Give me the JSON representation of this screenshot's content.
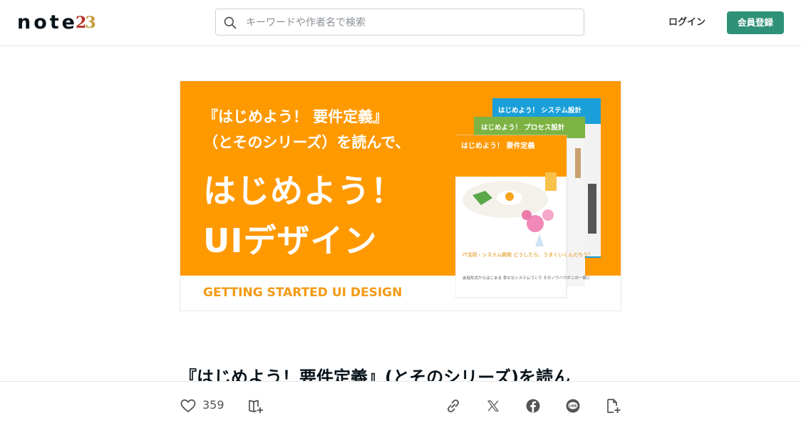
{
  "header": {
    "logo_text": "note",
    "logo_badge_first": "2",
    "logo_badge_second": "3",
    "search_placeholder": "キーワードや作者名で検索",
    "login_label": "ログイン",
    "signup_label": "会員登録",
    "accent_color": "#2f9177"
  },
  "hero": {
    "line1": "『はじめよう！ 要件定義』",
    "line2": "（とそのシリーズ）を読んで、",
    "big1": "はじめよう！",
    "big2": "UIデザイン",
    "subtitle": "GETTING STARTED UI DESIGN",
    "background_color": "#ff9900",
    "books": [
      {
        "title": "はじめよう！ システム設計",
        "color": "#1a9fd9"
      },
      {
        "title": "はじめよう！ プロセス設計",
        "color": "#7cb342"
      },
      {
        "title": "はじめよう！ 要件定義",
        "color": "#ffffff",
        "tagline": "IT活用・システム開発 どうしたら、うまくいくんだろう？",
        "note": "会話形式からはじまる 幸せなシステムづくり そのノウハウがこの一冊に"
      }
    ]
  },
  "article": {
    "title": "『はじめよう！要件定義』(とそのシリーズ)を読ん"
  },
  "actions": {
    "like_count": "359",
    "icons": [
      "heart-icon",
      "magazine-add-icon",
      "link-icon",
      "x-icon",
      "facebook-icon",
      "line-icon",
      "clip-icon"
    ]
  }
}
